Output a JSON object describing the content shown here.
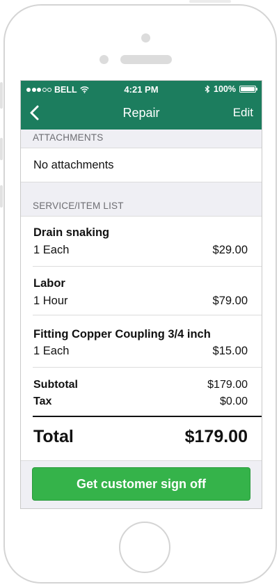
{
  "status_bar": {
    "carrier": "BELL",
    "time": "4:21 PM",
    "battery": "100%",
    "signal_icon": "signal-dots-icon",
    "wifi_icon": "wifi-icon",
    "bluetooth_icon": "bluetooth-icon",
    "battery_icon": "battery-icon"
  },
  "nav": {
    "title": "Repair",
    "edit_label": "Edit",
    "back_icon": "chevron-left-icon"
  },
  "attachments": {
    "header": "ATTACHMENTS",
    "empty_text": "No attachments"
  },
  "service_list": {
    "header": "SERVICE/ITEM LIST",
    "items": [
      {
        "name": "Drain snaking",
        "qty": "1 Each",
        "price": "$29.00"
      },
      {
        "name": "Labor",
        "qty": "1 Hour",
        "price": "$79.00"
      },
      {
        "name": "Fitting Copper Coupling 3/4 inch",
        "qty": "1 Each",
        "price": "$15.00"
      }
    ]
  },
  "summary": {
    "subtotal_label": "Subtotal",
    "subtotal_value": "$179.00",
    "tax_label": "Tax",
    "tax_value": "$0.00",
    "total_label": "Total",
    "total_value": "$179.00"
  },
  "actions": {
    "signoff_label": "Get customer sign off"
  },
  "colors": {
    "header_green": "#1c7d5e",
    "button_green": "#35b34a",
    "background": "#efeff4"
  }
}
